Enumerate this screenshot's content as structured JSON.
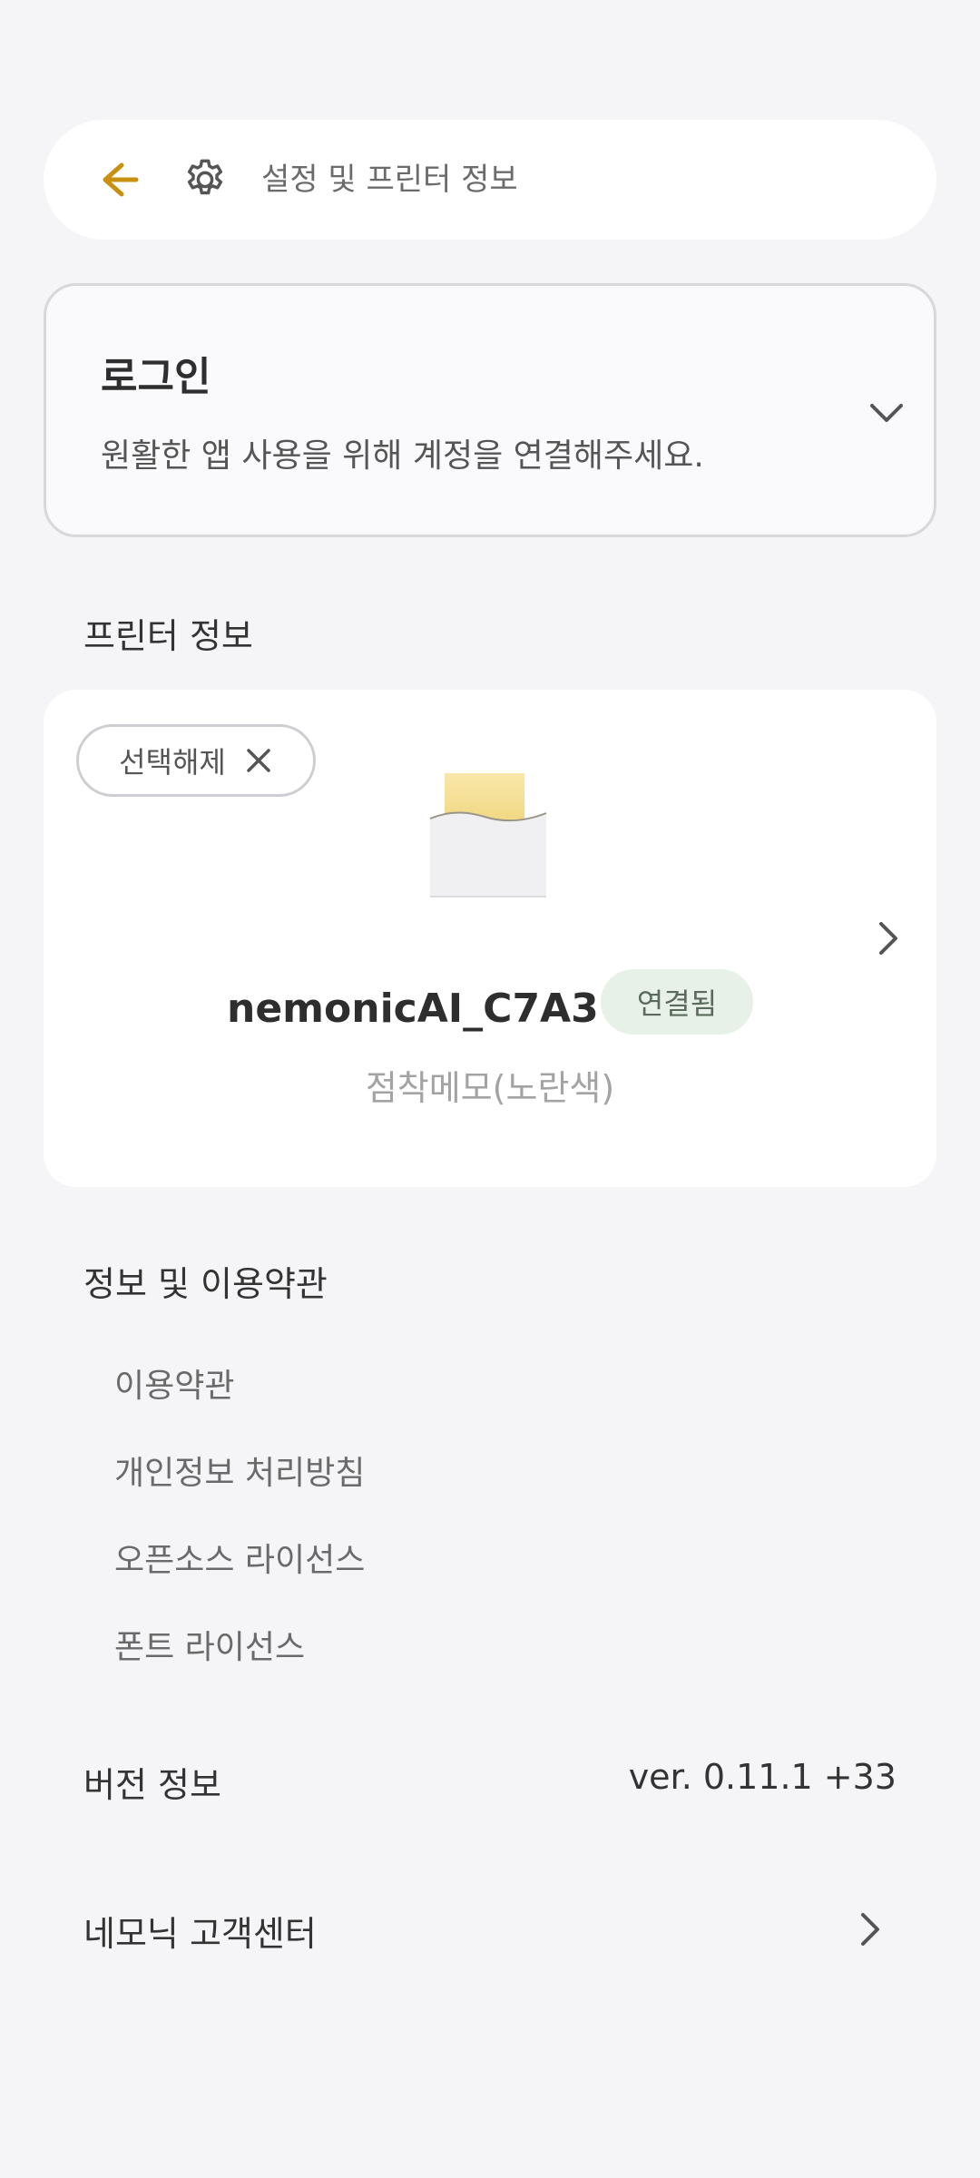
{
  "header": {
    "title": "설정 및 프린터 정보",
    "back_icon": "arrow-left-icon",
    "settings_icon": "gear-icon",
    "accent_color": "#c8900e"
  },
  "login": {
    "title": "로그인",
    "description": "원활한 앱 사용을 위해 계정을 연결해주세요.",
    "expand_icon": "chevron-down-icon"
  },
  "printer_section": {
    "label": "프린터 정보",
    "deselect_label": "선택해제",
    "deselect_icon": "close-icon",
    "device_name": "nemonicAI_C7A3",
    "status": "연결됨",
    "paper_type": "점착메모(노란색)",
    "detail_icon": "chevron-right-icon",
    "paper_color": "#f7e08e"
  },
  "info_section": {
    "label": "정보 및 이용약관",
    "items": [
      {
        "label": "이용약관"
      },
      {
        "label": "개인정보 처리방침"
      },
      {
        "label": "오픈소스 라이선스"
      },
      {
        "label": "폰트 라이선스"
      }
    ]
  },
  "version": {
    "label": "버전 정보",
    "value": "ver. 0.11.1 +33"
  },
  "support": {
    "label": "네모닉 고객센터",
    "icon": "chevron-right-icon"
  }
}
